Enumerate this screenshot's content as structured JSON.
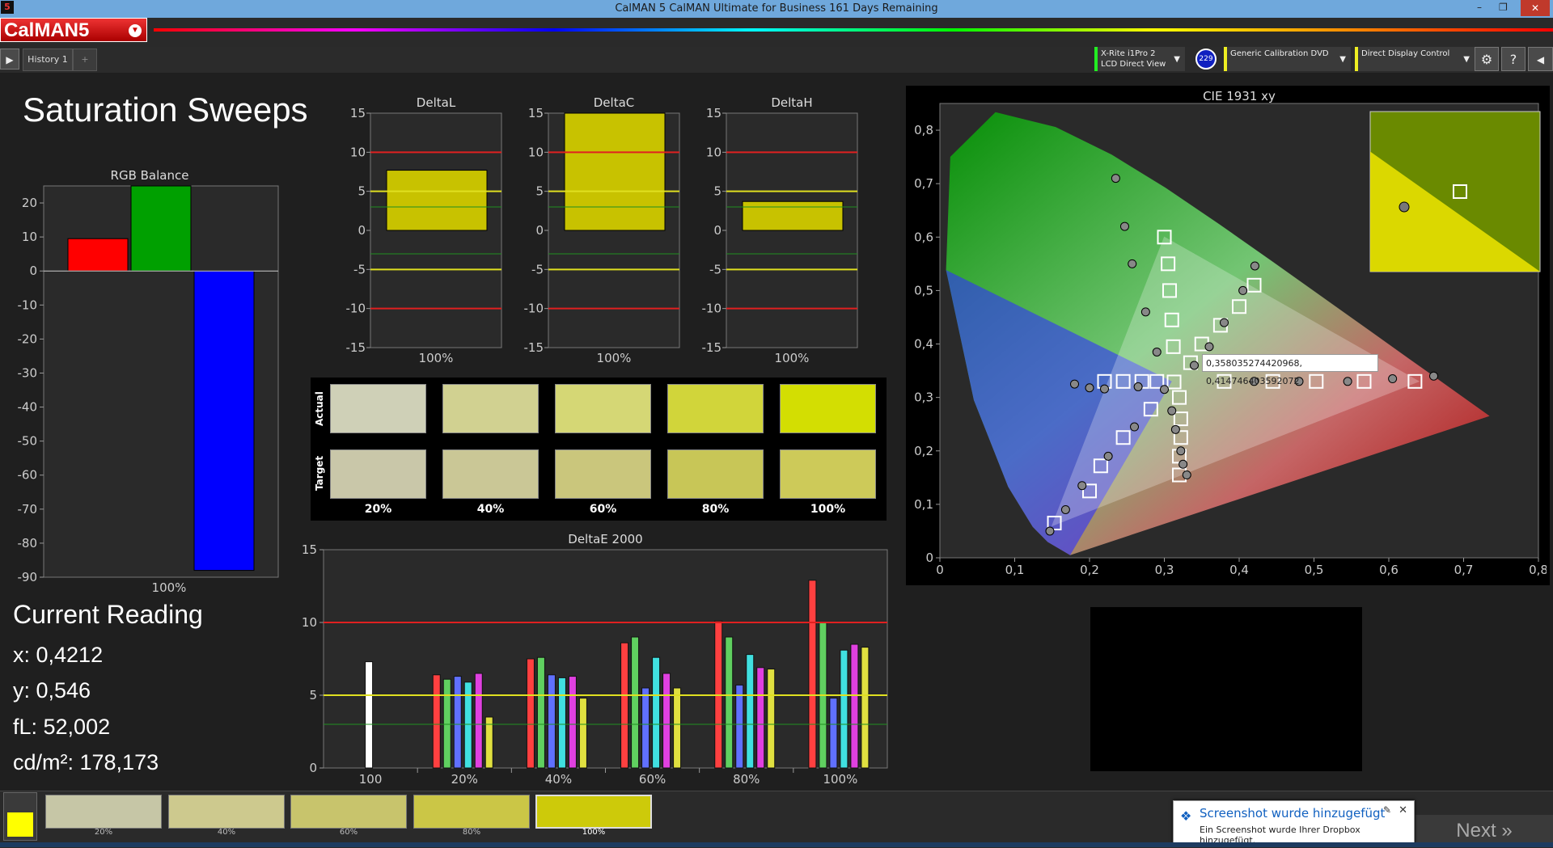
{
  "window": {
    "title": "CalMAN 5 CalMAN Ultimate for Business 161 Days Remaining",
    "app_icon": "5"
  },
  "brand": {
    "logo_text": "CalMAN5"
  },
  "tabs": [
    {
      "label": "History 1"
    },
    {
      "label": "+"
    }
  ],
  "devices": [
    {
      "line1": "X-Rite i1Pro 2",
      "line2": "LCD Direct View",
      "badge": "229",
      "color": "#22dd22"
    },
    {
      "line1": "Generic Calibration DVD",
      "line2": "",
      "color": "#eeee22"
    },
    {
      "line1": "Direct Display Control",
      "line2": "",
      "color": "#eeee22"
    }
  ],
  "toolbar_icons": [
    "gear-icon",
    "help-icon",
    "back-icon"
  ],
  "page": {
    "title": "Saturation Sweeps"
  },
  "charts_labels": {
    "rgb_balance": "RGB Balance",
    "deltaL": "DeltaL",
    "deltaC": "DeltaC",
    "deltaH": "DeltaH",
    "deltaE": "DeltaE 2000",
    "cie": "CIE 1931 xy"
  },
  "chart_data": [
    {
      "name": "RGB Balance",
      "type": "bar",
      "title": "RGB Balance",
      "categories": [
        "100%"
      ],
      "series": [
        {
          "name": "Red",
          "color": "#ff0000",
          "values": [
            9.5
          ]
        },
        {
          "name": "Green",
          "color": "#00a000",
          "values": [
            25
          ]
        },
        {
          "name": "Blue",
          "color": "#0000ff",
          "values": [
            -88
          ]
        }
      ],
      "ylim": [
        -90,
        25
      ],
      "yticks": [
        20,
        10,
        0,
        -10,
        -20,
        -30,
        -40,
        -50,
        -60,
        -70,
        -80,
        -90
      ]
    },
    {
      "name": "DeltaL",
      "type": "bar",
      "title": "DeltaL",
      "categories": [
        "100%"
      ],
      "values": [
        7.7
      ],
      "ylim": [
        -15,
        15
      ],
      "yticks": [
        15,
        10,
        5,
        0,
        -5,
        -10,
        -15
      ],
      "ref_lines": [
        10,
        5,
        -5,
        -10,
        3,
        -3
      ]
    },
    {
      "name": "DeltaC",
      "type": "bar",
      "title": "DeltaC",
      "categories": [
        "100%"
      ],
      "values": [
        15
      ],
      "ylim": [
        -15,
        15
      ],
      "yticks": [
        15,
        10,
        5,
        0,
        -5,
        -10,
        -15
      ],
      "ref_lines": [
        10,
        5,
        -5,
        -10,
        3,
        -3
      ]
    },
    {
      "name": "DeltaH",
      "type": "bar",
      "title": "DeltaH",
      "categories": [
        "100%"
      ],
      "values": [
        3.7
      ],
      "ylim": [
        -15,
        15
      ],
      "yticks": [
        15,
        10,
        5,
        0,
        -5,
        -10,
        -15
      ],
      "ref_lines": [
        10,
        5,
        -5,
        -10,
        3,
        -3
      ]
    },
    {
      "name": "DeltaE 2000",
      "type": "bar",
      "title": "DeltaE 2000",
      "categories": [
        "100",
        "20%",
        "40%",
        "60%",
        "80%",
        "100%"
      ],
      "series": [
        {
          "name": "White",
          "color": "#ffffff",
          "values": [
            7.3,
            null,
            null,
            null,
            null,
            null
          ]
        },
        {
          "name": "Red",
          "color": "#ff4040",
          "values": [
            null,
            6.4,
            7.5,
            8.6,
            10.1,
            12.9
          ]
        },
        {
          "name": "Green",
          "color": "#60d060",
          "values": [
            null,
            6.1,
            7.6,
            9.0,
            9.0,
            10.0
          ]
        },
        {
          "name": "Blue",
          "color": "#6070ff",
          "values": [
            null,
            6.3,
            6.4,
            5.5,
            5.7,
            4.8
          ]
        },
        {
          "name": "Cyan",
          "color": "#40e0e0",
          "values": [
            null,
            5.9,
            6.2,
            7.6,
            7.8,
            8.1
          ]
        },
        {
          "name": "Magenta",
          "color": "#e040e0",
          "values": [
            null,
            6.5,
            6.3,
            6.5,
            6.9,
            8.5
          ]
        },
        {
          "name": "Yellow",
          "color": "#e0e040",
          "values": [
            null,
            3.5,
            4.8,
            5.5,
            6.8,
            8.3
          ]
        }
      ],
      "ylim": [
        0,
        15
      ],
      "yticks": [
        15,
        10,
        5,
        0
      ],
      "ref_lines": [
        10,
        5,
        3
      ]
    },
    {
      "name": "CIE 1931 xy",
      "type": "scatter",
      "title": "CIE 1931 xy",
      "xlim": [
        0,
        0.8
      ],
      "ylim": [
        0,
        0.85
      ],
      "xticks": [
        "0",
        "0,1",
        "0,2",
        "0,3",
        "0,4",
        "0,5",
        "0,6",
        "0,7",
        "0,8"
      ],
      "yticks": [
        "0",
        "0,1",
        "0,2",
        "0,3",
        "0,4",
        "0,5",
        "0,6",
        "0,7",
        "0,8"
      ],
      "gamut": [
        [
          0.64,
          0.33
        ],
        [
          0.3,
          0.6
        ],
        [
          0.15,
          0.06
        ]
      ],
      "targets": [
        [
          0.153,
          0.065
        ],
        [
          0.2,
          0.125
        ],
        [
          0.215,
          0.172
        ],
        [
          0.245,
          0.225
        ],
        [
          0.282,
          0.278
        ],
        [
          0.313,
          0.329
        ],
        [
          0.3,
          0.6
        ],
        [
          0.305,
          0.55
        ],
        [
          0.307,
          0.5
        ],
        [
          0.31,
          0.445
        ],
        [
          0.312,
          0.395
        ],
        [
          0.635,
          0.33
        ],
        [
          0.567,
          0.33
        ],
        [
          0.503,
          0.33
        ],
        [
          0.445,
          0.33
        ],
        [
          0.38,
          0.33
        ],
        [
          0.22,
          0.33
        ],
        [
          0.245,
          0.33
        ],
        [
          0.27,
          0.33
        ],
        [
          0.29,
          0.33
        ],
        [
          0.32,
          0.3
        ],
        [
          0.322,
          0.26
        ],
        [
          0.322,
          0.225
        ],
        [
          0.32,
          0.19
        ],
        [
          0.32,
          0.155
        ],
        [
          0.42,
          0.51
        ],
        [
          0.4,
          0.47
        ],
        [
          0.375,
          0.435
        ],
        [
          0.35,
          0.4
        ],
        [
          0.335,
          0.365
        ]
      ],
      "measured": [
        [
          0.147,
          0.05
        ],
        [
          0.168,
          0.09
        ],
        [
          0.19,
          0.135
        ],
        [
          0.225,
          0.19
        ],
        [
          0.26,
          0.245
        ],
        [
          0.235,
          0.71
        ],
        [
          0.247,
          0.62
        ],
        [
          0.257,
          0.55
        ],
        [
          0.275,
          0.46
        ],
        [
          0.29,
          0.385
        ],
        [
          0.66,
          0.34
        ],
        [
          0.605,
          0.335
        ],
        [
          0.545,
          0.33
        ],
        [
          0.48,
          0.33
        ],
        [
          0.42,
          0.33
        ],
        [
          0.18,
          0.325
        ],
        [
          0.2,
          0.318
        ],
        [
          0.22,
          0.316
        ],
        [
          0.265,
          0.32
        ],
        [
          0.3,
          0.315
        ],
        [
          0.31,
          0.275
        ],
        [
          0.315,
          0.24
        ],
        [
          0.322,
          0.2
        ],
        [
          0.325,
          0.175
        ],
        [
          0.33,
          0.155
        ],
        [
          0.421,
          0.546
        ],
        [
          0.405,
          0.5
        ],
        [
          0.38,
          0.44
        ],
        [
          0.36,
          0.395
        ],
        [
          0.34,
          0.36
        ]
      ],
      "inset_point": [
        0.421,
        0.546
      ],
      "tooltip": "0,358035274420968, 0,414746403592072"
    }
  ],
  "swatches": {
    "row_labels": [
      "Actual",
      "Target"
    ],
    "columns": [
      "20%",
      "40%",
      "60%",
      "80%",
      "100%"
    ],
    "actual_colors": [
      "#cfd0b7",
      "#d1d191",
      "#d5d775",
      "#d1d53a",
      "#d3de02"
    ],
    "target_colors": [
      "#c9c7a9",
      "#cac796",
      "#cac67c",
      "#c8c657",
      "#cdca59"
    ]
  },
  "current_reading": {
    "title": "Current Reading",
    "x": "x: 0,4212",
    "y": "y: 0,546",
    "fl": "fL: 52,002",
    "cd": "cd/m²: 178,173"
  },
  "bottom_tiles": [
    {
      "label": "20%",
      "color": "#c6c6a6"
    },
    {
      "label": "40%",
      "color": "#cdc98e"
    },
    {
      "label": "60%",
      "color": "#c8c46c"
    },
    {
      "label": "80%",
      "color": "#cbc646"
    },
    {
      "label": "100%",
      "color": "#cdca0a"
    }
  ],
  "indicator_color": "#ffff00",
  "next_label": "Next",
  "toast": {
    "heading": "Screenshot wurde hinzugefügt",
    "body": "Ein Screenshot wurde Ihrer Dropbox hinzugefügt."
  }
}
